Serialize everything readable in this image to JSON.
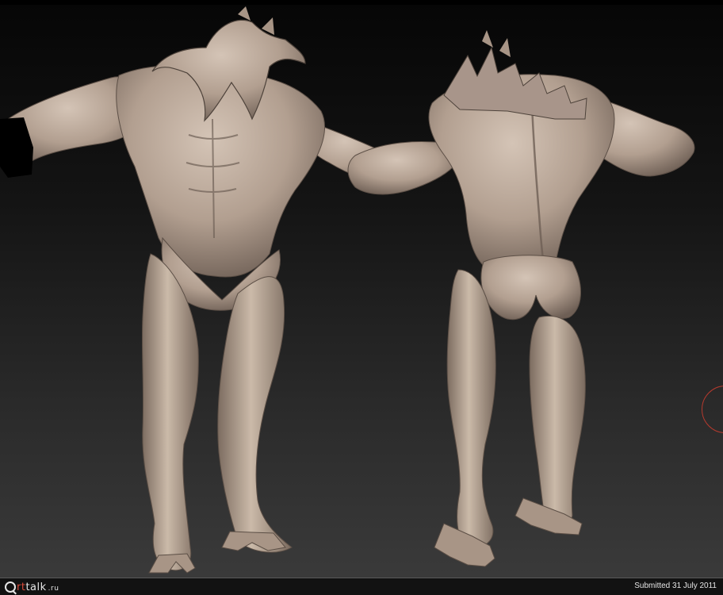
{
  "footer": {
    "logo_prefix": "A",
    "logo_accent": "rt",
    "logo_rest": "talk",
    "logo_tld": ".ru",
    "submitted_text": "Submitted 31 July 2011"
  },
  "colors": {
    "sculpt_base": "#b8a698",
    "sculpt_shadow": "#6e5f55",
    "accent_red": "#d94b3a",
    "cursor_ring": "#b53a2e"
  },
  "icons": {
    "logo": "arttalk-logo-icon",
    "cursor": "brush-cursor-ring-icon"
  }
}
